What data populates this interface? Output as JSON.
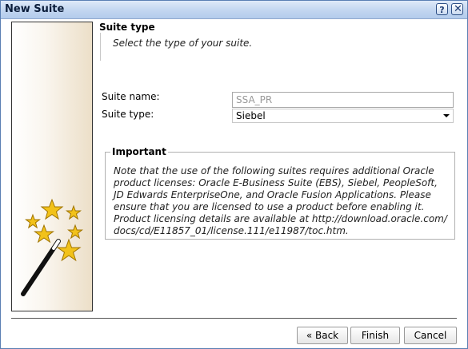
{
  "window": {
    "title": "New Suite",
    "help_glyph": "?",
    "close_glyph": "✕",
    "help_icon": "help-icon",
    "close_icon": "close-icon"
  },
  "side_panel": {
    "image": "magic-wand-stars-icon"
  },
  "section": {
    "title": "Suite type",
    "subtitle": "Select the type of your suite."
  },
  "form": {
    "suite_name_label": "Suite name:",
    "suite_name_value": "SSA_PR",
    "suite_type_label": "Suite type:",
    "suite_type_value": "Siebel"
  },
  "important": {
    "legend": "Important",
    "lines": [
      "Note that the use of the following suites requires additional Oracle",
      "product licenses: Oracle E-Business Suite (EBS), Siebel, PeopleSoft,",
      "JD Edwards EnterpriseOne, and Oracle Fusion Applications. Please",
      "ensure that you are licensed to use a product before enabling it.",
      "Product licensing details are available at http://download.oracle.com/",
      "docs/cd/E11857_01/license.111/e11987/toc.htm."
    ]
  },
  "buttons": {
    "back": "« Back",
    "finish": "Finish",
    "cancel": "Cancel"
  },
  "colors": {
    "titlebar": "#c2d6f0",
    "star": "#f2c21a",
    "wand": "#111111"
  }
}
